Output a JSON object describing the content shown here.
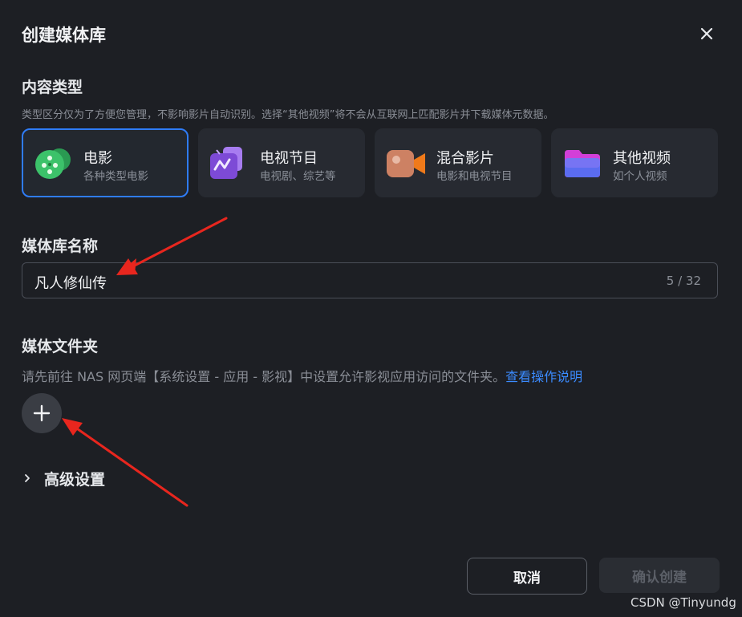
{
  "dialog": {
    "title": "创建媒体库",
    "close_icon": "close-icon"
  },
  "content_type": {
    "label": "内容类型",
    "hint": "类型区分仅为了方便您管理，不影响影片自动识别。选择“其他视频”将不会从互联网上匹配影片并下载媒体元数据。",
    "selected": "电影",
    "options": [
      {
        "title": "电影",
        "subtitle": "各种类型电影",
        "icon": "movie-reel-icon",
        "color": "#3cc26a"
      },
      {
        "title": "电视节目",
        "subtitle": "电视剧、综艺等",
        "icon": "tv-icon",
        "color": "#8f5ce6"
      },
      {
        "title": "混合影片",
        "subtitle": "电影和电视节目",
        "icon": "video-camera-icon",
        "color": "#f07a3a"
      },
      {
        "title": "其他视频",
        "subtitle": "如个人视频",
        "icon": "folder-icon",
        "color": "#5b6cf0"
      }
    ]
  },
  "library_name": {
    "label": "媒体库名称",
    "value": "凡人修仙传",
    "counter": "5 / 32"
  },
  "media_folder": {
    "label": "媒体文件夹",
    "hint": "请先前往 NAS 网页端【系统设置 - 应用 - 影视】中设置允许影视应用访问的文件夹。",
    "link": "查看操作说明",
    "add_icon": "plus-icon"
  },
  "advanced": {
    "label": "高级设置",
    "icon": "chevron-right-icon"
  },
  "footer": {
    "cancel_label": "取消",
    "confirm_label": "确认创建"
  },
  "watermark": "CSDN @Tinyundg",
  "colors": {
    "background": "#1d1f24",
    "accent": "#2f7cf6",
    "link": "#3b8bff",
    "annotation_arrow": "#e8261e"
  }
}
